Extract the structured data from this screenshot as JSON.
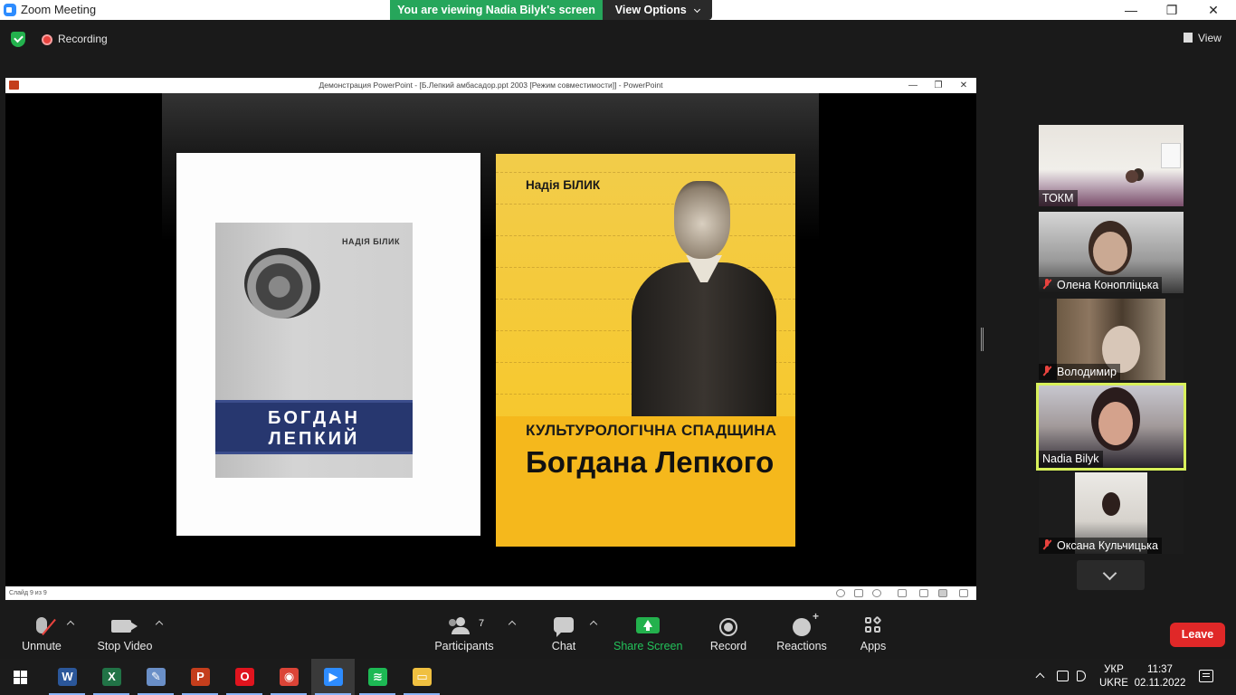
{
  "window": {
    "title": "Zoom Meeting",
    "minimize": "—",
    "restore": "❐",
    "close": "✕"
  },
  "banner": {
    "viewing": "You are viewing Nadia Bilyk's screen",
    "view_options": "View Options"
  },
  "status": {
    "recording": "Recording",
    "view": "View"
  },
  "shared_screen": {
    "window_title": "Демонстрация PowerPoint - [Б.Лепкий амбасадор.ppt 2003 [Режим совместимости]] - PowerPoint",
    "slide_counter": "Слайд 9 из 9",
    "left_cover": {
      "author": "НАДІЯ БІЛИК",
      "title_line1": "БОГДАН",
      "title_line2": "ЛЕПКИЙ"
    },
    "right_cover": {
      "author": "Надія БІЛИК",
      "title_line1": "КУЛЬТУРОЛОГІЧНА СПАДЩИНА",
      "title_line2": "Богдана Лепкого"
    }
  },
  "participants_gallery": [
    {
      "name": "ТОКМ",
      "muted": false
    },
    {
      "name": "Олена Конопліцька",
      "muted": true
    },
    {
      "name": "Володимир",
      "muted": true
    },
    {
      "name": "Nadia Bilyk",
      "muted": false,
      "active_speaker": true
    },
    {
      "name": "Оксана Кульчицька",
      "muted": true
    }
  ],
  "toolbar": {
    "unmute": "Unmute",
    "stop_video": "Stop Video",
    "participants": "Participants",
    "participants_count": "7",
    "chat": "Chat",
    "share_screen": "Share Screen",
    "record": "Record",
    "reactions": "Reactions",
    "apps": "Apps",
    "leave": "Leave"
  },
  "taskbar": {
    "apps": [
      {
        "name": "word",
        "glyph": "W",
        "color": "#2b579a"
      },
      {
        "name": "excel",
        "glyph": "X",
        "color": "#217346"
      },
      {
        "name": "paint",
        "glyph": "✎",
        "color": "#6a8fc7"
      },
      {
        "name": "powerpoint",
        "glyph": "P",
        "color": "#c43e1c"
      },
      {
        "name": "opera",
        "glyph": "O",
        "color": "#e0141e"
      },
      {
        "name": "chrome",
        "glyph": "◉",
        "color": "#db4437"
      },
      {
        "name": "zoom",
        "glyph": "▶",
        "color": "#2d8cff"
      },
      {
        "name": "spotify",
        "glyph": "≋",
        "color": "#1db954"
      },
      {
        "name": "file-explorer",
        "glyph": "▭",
        "color": "#f0c040"
      }
    ],
    "language_line1": "УКР",
    "language_line2": "UKRE",
    "time": "11:37",
    "date": "02.11.2022"
  }
}
